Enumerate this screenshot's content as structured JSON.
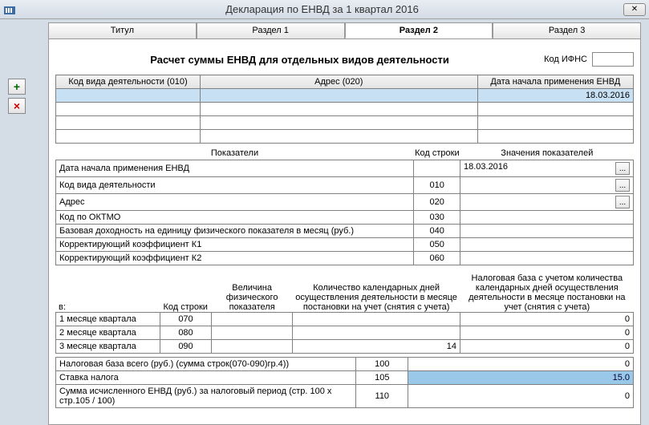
{
  "window": {
    "title": "Декларация по ЕНВД за 1 квартал 2016",
    "close": "✕"
  },
  "tabs": {
    "t0": "Титул",
    "t1": "Раздел 1",
    "t2": "Раздел 2",
    "t3": "Раздел 3"
  },
  "heading": "Расчет суммы ЕНВД для отдельных видов деятельности",
  "kod_ifns_label": "Код ИФНС",
  "kod_ifns_value": "",
  "sidebtn": {
    "add": "+",
    "del": "×"
  },
  "top_grid": {
    "h1": "Код вида деятельности (010)",
    "h2": "Адрес (020)",
    "h3": "Дата начала применения ЕНВД",
    "row1": {
      "c1": "",
      "c2": "",
      "c3": "18.03.2016"
    }
  },
  "mid_headers": {
    "h1": "Показатели",
    "h2": "Код строки",
    "h3": "Значения показателей"
  },
  "params": [
    {
      "lbl": "Дата начала применения ЕНВД",
      "code": "",
      "val": "18.03.2016",
      "dots": true
    },
    {
      "lbl": "Код вида деятельности",
      "code": "010",
      "val": "",
      "dots": true
    },
    {
      "lbl": "Адрес",
      "code": "020",
      "val": "",
      "dots": true
    },
    {
      "lbl": "Код по ОКТМО",
      "code": "030",
      "val": "",
      "dots": false
    },
    {
      "lbl": "Базовая доходность на единицу физического показателя в месяц (руб.)",
      "code": "040",
      "val": "",
      "dots": false
    },
    {
      "lbl": "Корректирующий коэффициент К1",
      "code": "050",
      "val": "",
      "dots": false
    },
    {
      "lbl": "Корректирующий коэффициент К2",
      "code": "060",
      "val": "",
      "dots": false
    }
  ],
  "colheads3": {
    "c1": "в:",
    "c2": "Код строки",
    "c3": "Величина физического показателя",
    "c4": "Количество календарных дней осуществления деятельности в месяце постановки на учет (снятия с учета)",
    "c5": "Налоговая база с учетом количества календарных дней осуществления деятельности в месяце постановки на учет (снятия с учета)"
  },
  "months": [
    {
      "m1": "1 месяце квартала",
      "m2": "070",
      "m3": "",
      "m4": "",
      "m5": "0"
    },
    {
      "m1": "2 месяце квартала",
      "m2": "080",
      "m3": "",
      "m4": "",
      "m5": "0"
    },
    {
      "m1": "3 месяце квартала",
      "m2": "090",
      "m3": "",
      "m4": "14",
      "m5": "0"
    }
  ],
  "totals": [
    {
      "t1": "Налоговая база  всего (руб.)  (сумма строк(070-090)гр.4))",
      "t2": "100",
      "t3": "0",
      "hl": false
    },
    {
      "t1": "Ставка налога",
      "t2": "105",
      "t3": "15.0",
      "hl": true
    },
    {
      "t1": "Сумма исчисленного ЕНВД (руб.) за налоговый период  (стр. 100 x стр.105 / 100)",
      "t2": "110",
      "t3": "0",
      "hl": false
    }
  ]
}
